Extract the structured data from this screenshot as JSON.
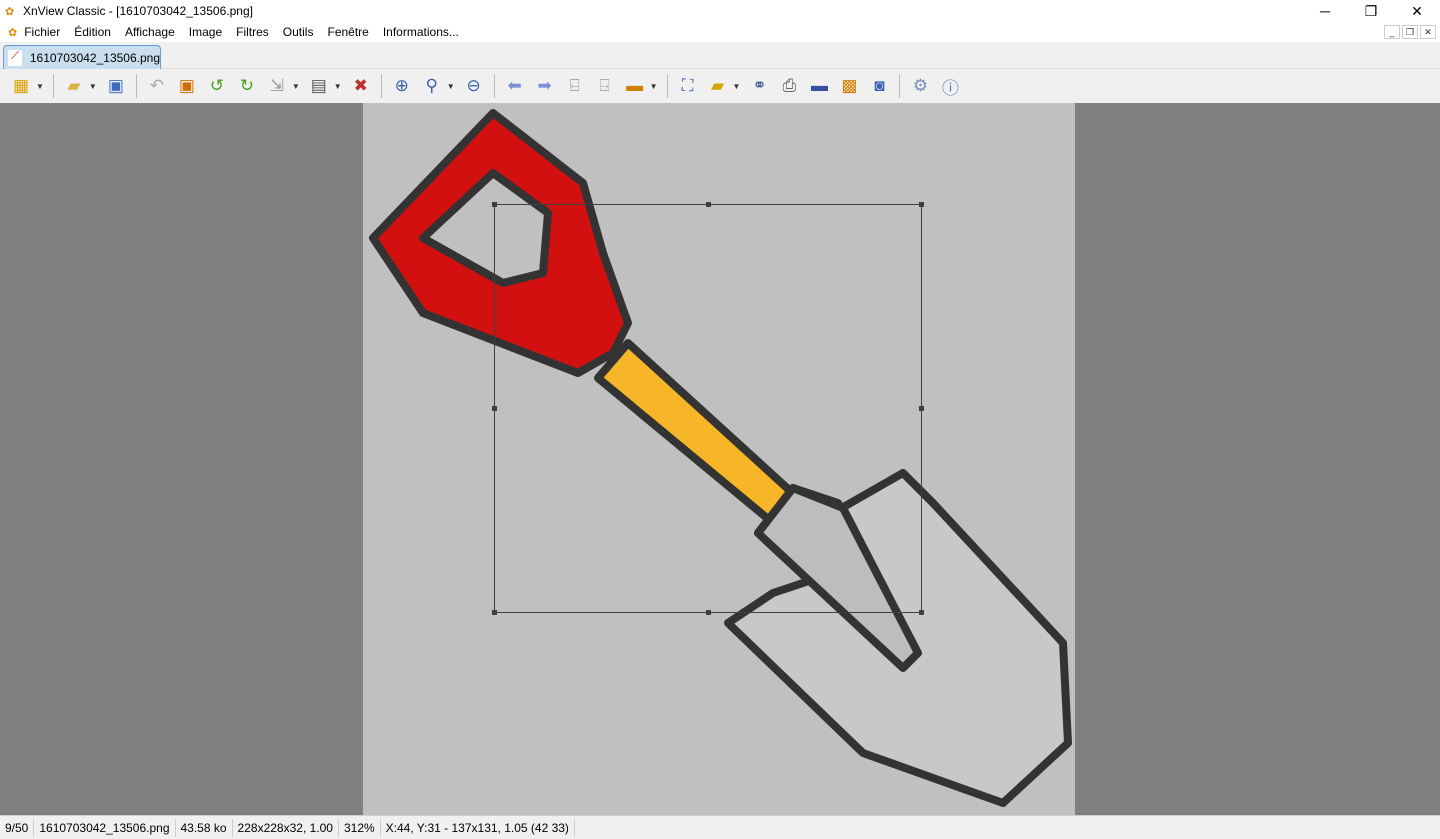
{
  "window": {
    "title": "XnView Classic - [1610703042_13506.png]",
    "minimize": "─",
    "maximize": "❐",
    "close": "✕"
  },
  "menu": [
    "Fichier",
    "Édition",
    "Affichage",
    "Image",
    "Filtres",
    "Outils",
    "Fenêtre",
    "Informations..."
  ],
  "tab": {
    "label": "1610703042_13506.png"
  },
  "toolbar": [
    "browser-icon",
    "open-folder-icon",
    "save-icon",
    "undo-icon",
    "crop-icon",
    "rotate-left-icon",
    "rotate-right-icon",
    "resize-icon",
    "adjust-colors-icon",
    "red-eye-icon",
    "zoom-in-icon",
    "zoom-1-1-icon",
    "zoom-out-icon",
    "previous-icon",
    "next-icon",
    "previous-page-icon",
    "next-page-icon",
    "slideshow-icon",
    "fullscreen-icon",
    "convert-icon",
    "find-icon",
    "print-icon",
    "scan-icon",
    "batch-icon",
    "capture-icon",
    "settings-icon",
    "info-icon"
  ],
  "status": {
    "index": "9/50",
    "filename": "1610703042_13506.png",
    "filesize": "43.58 ko",
    "dimensions": "228x228x32, 1.00",
    "zoom": "312%",
    "selection": "X:44, Y:31 - 137x131, 1.05 (42 33)"
  }
}
